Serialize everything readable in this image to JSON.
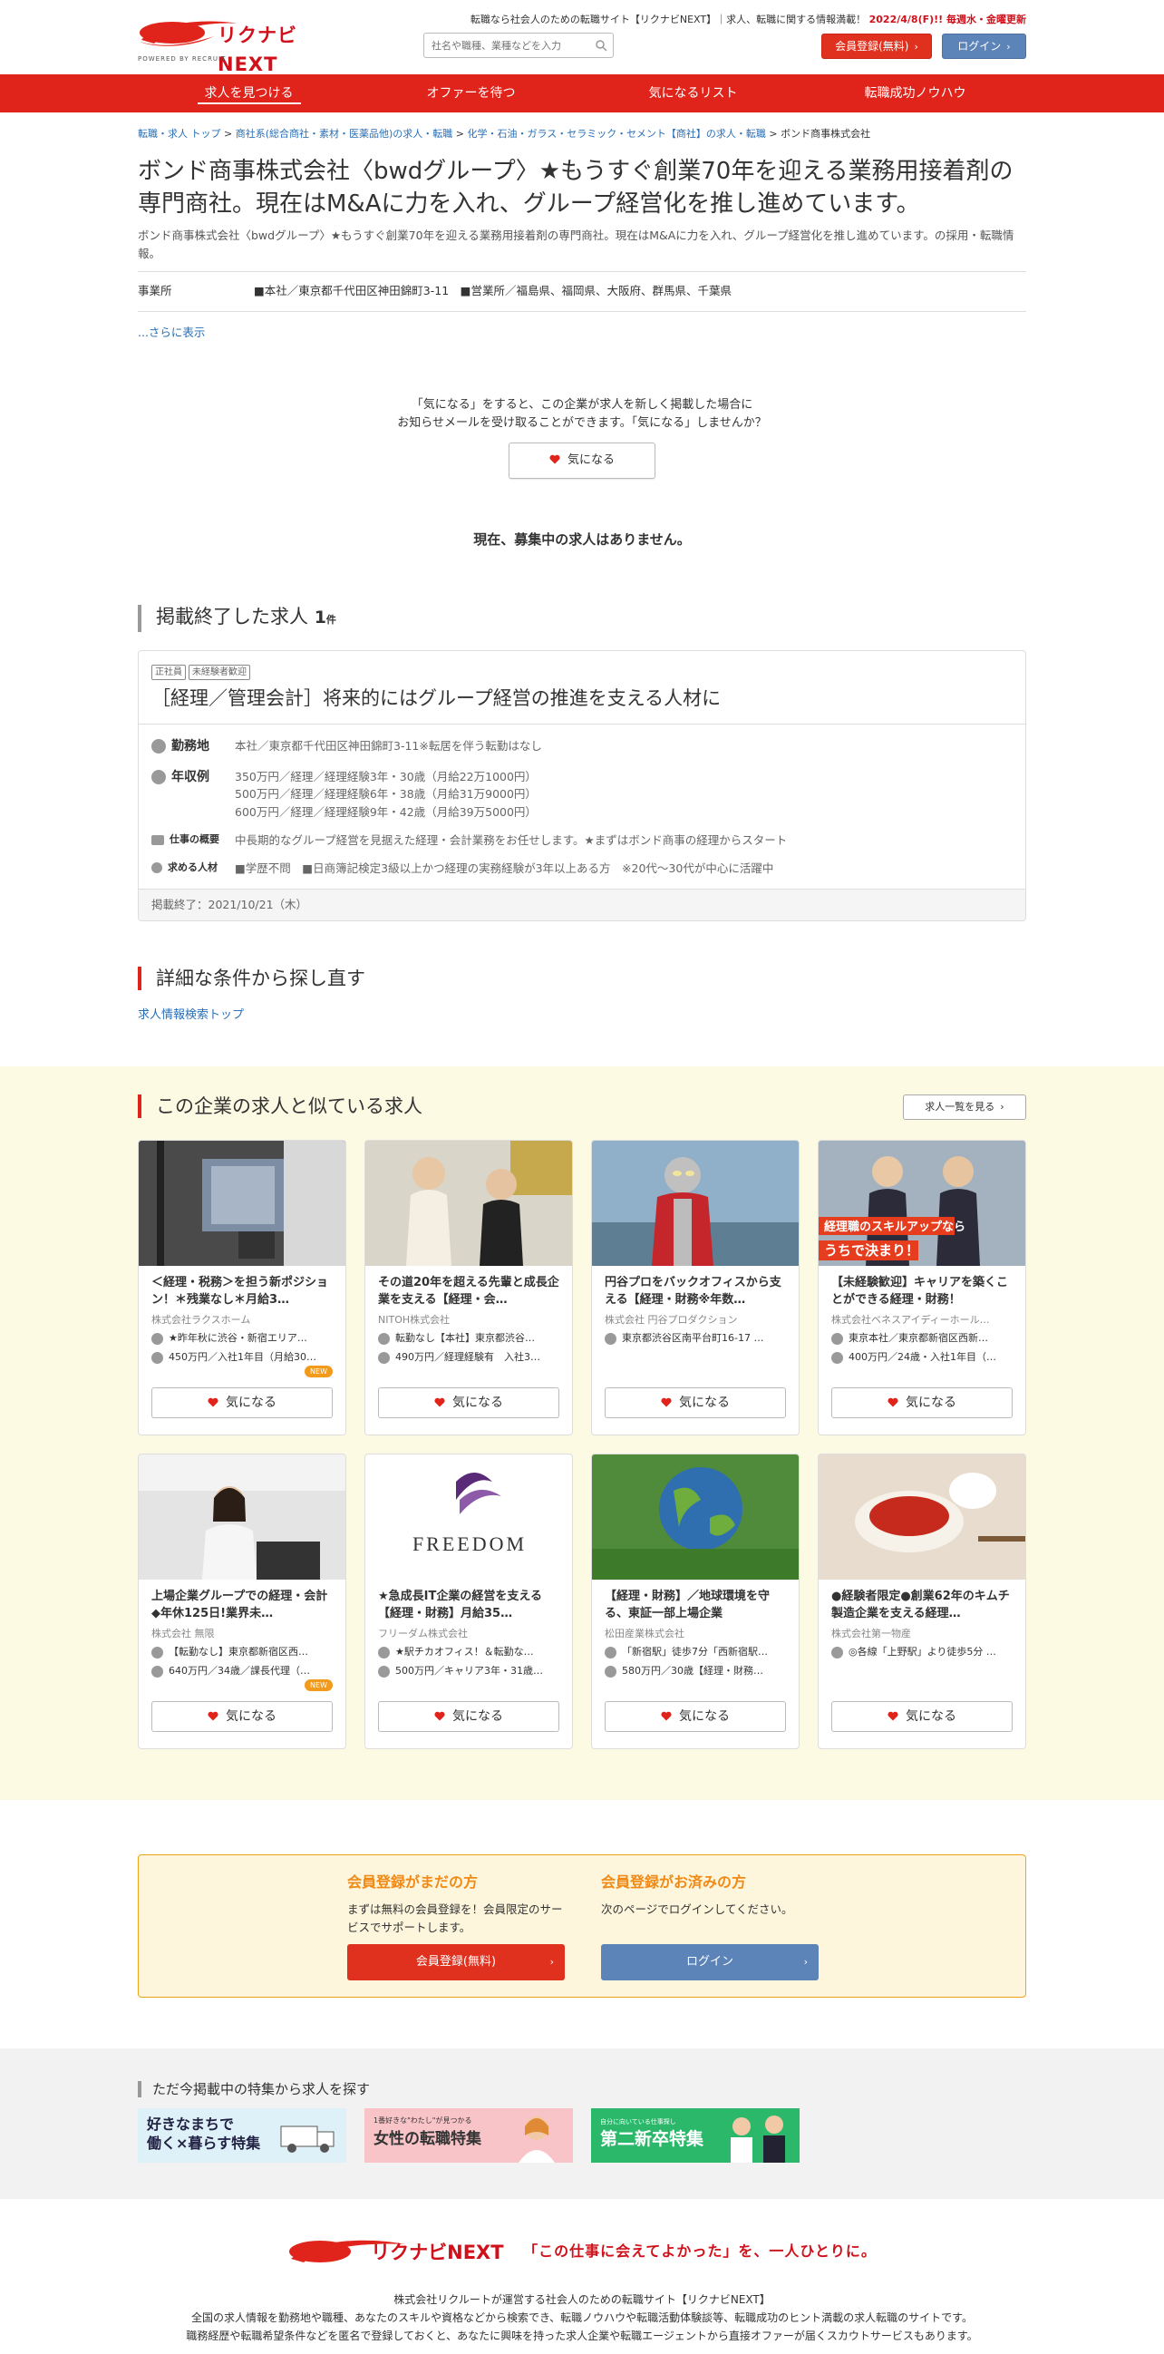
{
  "header": {
    "brand": "リクナビNEXT",
    "powered": "POWERED BY RECRUIT",
    "tagline_prefix": "転職なら社会人のための転職サイト【リクナビNEXT】｜求人、転職に関する情報満載！",
    "tagline_highlight": "2022/4/8(F)!! 毎週水・金曜更新",
    "search_placeholder": "社名や職種、業種などを入力",
    "register_label": "会員登録(無料)",
    "login_label": "ログイン"
  },
  "nav": [
    {
      "label": "求人を見つける",
      "active": true
    },
    {
      "label": "オファーを待つ",
      "active": false
    },
    {
      "label": "気になるリスト",
      "active": false
    },
    {
      "label": "転職成功ノウハウ",
      "active": false
    }
  ],
  "breadcrumb": [
    "転職・求人 トップ",
    "商社系(総合商社・素材・医薬品他)の求人・転職",
    "化学・石油・ガラス・セラミック・セメント【商社】の求人・転職",
    "ボンド商事株式会社"
  ],
  "company": {
    "title": "ボンド商事株式会社〈bwdグループ〉★もうすぐ創業70年を迎える業務用接着剤の専門商社。現在はM&Aに力を入れ、グループ経営化を推し進めています。",
    "lead": "ボンド商事株式会社〈bwdグループ〉★もうすぐ創業70年を迎える業務用接着剤の専門商社。現在はM&Aに力を入れ、グループ経営化を推し進めています。の採用・転職情報。",
    "office_label": "事業所",
    "office_value": "■本社／東京都千代田区神田錦町3-11　■営業所／福島県、福岡県、大阪府、群馬県、千葉県",
    "more_label": "...さらに表示"
  },
  "follow": {
    "line1": "「気になる」をすると、この企業が求人を新しく掲載した場合に",
    "line2": "お知らせメールを受け取ることができます。「気になる」しませんか？",
    "button": "気になる"
  },
  "no_jobs": "現在、募集中の求人はありません。",
  "ended_section": {
    "title": "掲載終了した求人",
    "count": "1",
    "unit": "件",
    "job": {
      "tags": [
        "正社員",
        "未経験者歓迎"
      ],
      "title": "［経理／管理会計］将来的にはグループ経営の推進を支える人材に",
      "loc_label": "勤務地",
      "loc_value": "本社／東京都千代田区神田錦町3-11※転居を伴う転勤はなし",
      "salary_label": "年収例",
      "salary_lines": [
        "350万円／経理／経理経験3年・30歳（月給22万1000円）",
        "500万円／経理／経理経験6年・38歳（月給31万9000円）",
        "600万円／経理／経理経験9年・42歳（月給39万5000円）"
      ],
      "summary_label": "仕事の概要",
      "summary_value": "中長期的なグループ経営を見据えた経理・会計業務をお任せします。★まずはボンド商事の経理からスタート",
      "req_label": "求める人材",
      "req_value": "■学歴不問　■日商簿記検定3級以上かつ経理の実務経験が3年以上ある方　※20代～30代が中心に活躍中",
      "ended": "掲載終了：2021/10/21（木）"
    }
  },
  "search_again": {
    "title": "詳細な条件から探し直す",
    "link": "求人情報検索トップ"
  },
  "similar": {
    "title": "この企業の求人と似ている求人",
    "list_button": "求人一覧を見る",
    "fav_label": "気になる",
    "new_label": "NEW",
    "cards": [
      {
        "title": "＜経理・税務＞を担う新ポジション！＊残業なし＊月給3…",
        "company": "株式会社ラクスホーム",
        "loc": "★昨年秋に渋谷・新宿エリア…",
        "salary": "450万円／入社1年目（月給30…",
        "is_new": true,
        "thumb": "office"
      },
      {
        "title": "その道20年を超える先輩と成長企業を支える【経理・会…",
        "company": "NITOH株式会社",
        "loc": "転勤なし【本社】東京都渋谷…",
        "salary": "490万円／経理経験有　入社3…",
        "is_new": false,
        "thumb": "women"
      },
      {
        "title": "円谷プロをバックオフィスから支える【経理・財務※年数…",
        "company": "株式会社 円谷プロダクション",
        "loc": "東京都渋谷区南平台町16-17 …",
        "salary": "",
        "is_new": false,
        "thumb": "hero"
      },
      {
        "title": "【未経験歓迎】キャリアを築くことができる経理・財務！",
        "company": "株式会社ベネスアイディーホール…",
        "loc": "東京本社／東京都新宿区西新…",
        "salary": "400万円／24歳・入社1年目（…",
        "is_new": false,
        "thumb": "men",
        "caption1": "経理職のスキルアップなら",
        "caption2": "うちで決まり！"
      },
      {
        "title": "上場企業グループでの経理・会計◆年休125日!業界未…",
        "company": "株式会社 無限",
        "loc": "【転勤なし】東京都新宿区西…",
        "salary": "640万円／34歳／課長代理（…",
        "is_new": true,
        "thumb": "worker"
      },
      {
        "title": "★急成長IT企業の経営を支える【経理・財務】月給35…",
        "company": "フリーダム株式会社",
        "loc": "★駅チカオフィス！＆転勤な…",
        "salary": "500万円／キャリア3年・31歳…",
        "is_new": false,
        "thumb": "freedom",
        "caption1": "FREEDOM"
      },
      {
        "title": "【経理・財務】／地球環境を守る、東証一部上場企業",
        "company": "松田産業株式会社",
        "loc": "「新宿駅」徒歩7分「西新宿駅…",
        "salary": "580万円／30歳【経理・財務…",
        "is_new": false,
        "thumb": "globe"
      },
      {
        "title": "●経験者限定●創業62年のキムチ製造企業を支える経理…",
        "company": "株式会社第一物産",
        "loc": "◎各線「上野駅」より徒歩5分 …",
        "salary": "",
        "is_new": false,
        "thumb": "kimchi"
      }
    ]
  },
  "member": {
    "new_title": "会員登録がまだの方",
    "new_text": "まずは無料の会員登録を！会員限定のサービスでサポートします。",
    "new_button": "会員登録(無料)",
    "existing_title": "会員登録がお済みの方",
    "existing_text": "次のページでログインしてください。",
    "existing_button": "ログイン"
  },
  "special": {
    "title": "ただ今掲載中の特集から求人を探す",
    "banners": [
      {
        "line1": "好きなまちで",
        "line2": "働く×暮らす特集",
        "bg": "#dff1f8"
      },
      {
        "line1": "1番好きな\"わたし\"が見つかる",
        "line2": "女性の転職特集",
        "bg": "#f8c4c8"
      },
      {
        "line1": "自分に向いている仕事探し",
        "line2": "第二新卒特集",
        "bg": "#2bb86b"
      }
    ]
  },
  "footer": {
    "brand": "リクナビNEXT",
    "catch": "「この仕事に会えてよかった」を、一人ひとりに。",
    "line1": "株式会社リクルートが運営する社会人のための転職サイト【リクナビNEXT】",
    "line2": "全国の求人情報を勤務地や職種、あなたのスキルや資格などから検索でき、転職ノウハウや転職活動体験談等、転職成功のヒント満載の求人転職のサイトです。",
    "line3": "職務経歴や転職希望条件などを匿名で登録しておくと、あなたに興味を持った求人企業や転職エージェントから直接オファーが届くスカウトサービスもあります。"
  },
  "colors": {
    "brand_red": "#e0241b",
    "accent_orange": "#f08a16",
    "login_blue": "#5d84b8",
    "similar_bg": "#fdfae3"
  }
}
